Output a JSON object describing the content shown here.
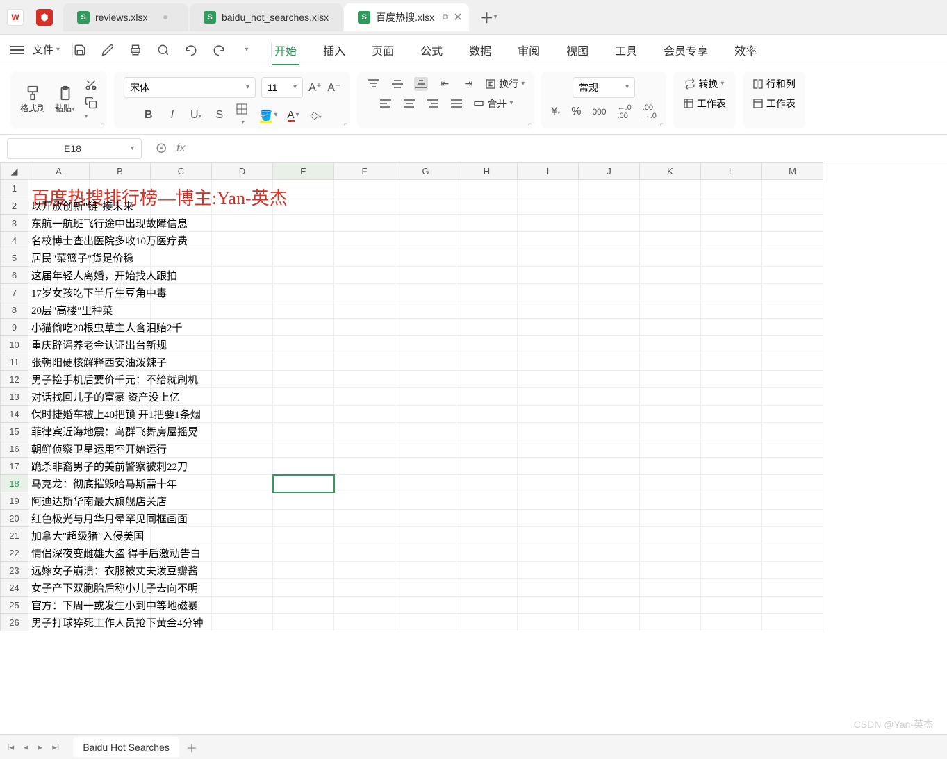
{
  "tabs": [
    {
      "label": "reviews.xlsx",
      "active": false,
      "hasDot": true
    },
    {
      "label": "baidu_hot_searches.xlsx",
      "active": false,
      "hasDot": false
    },
    {
      "label": "百度热搜.xlsx",
      "active": true,
      "hasDot": false,
      "hasWindowIcons": true
    }
  ],
  "menu": {
    "file": "文件",
    "tabs": [
      "开始",
      "插入",
      "页面",
      "公式",
      "数据",
      "审阅",
      "视图",
      "工具",
      "会员专享",
      "效率"
    ],
    "activeTab": "开始"
  },
  "ribbon": {
    "formatPainter": "格式刷",
    "paste": "粘贴",
    "fontName": "宋体",
    "fontSize": "11",
    "wrap": "换行",
    "merge": "合并",
    "numberFormat": "常规",
    "convert": "转换",
    "rowcol": "行和列",
    "worksheet": "工作表"
  },
  "formulaBar": {
    "nameBox": "E18",
    "fx": "fx",
    "formula": ""
  },
  "columns": [
    "A",
    "B",
    "C",
    "D",
    "E",
    "F",
    "G",
    "H",
    "I",
    "J",
    "K",
    "L",
    "M"
  ],
  "activeColumn": "E",
  "activeRow": 18,
  "selectedCell": "E18",
  "title": "百度热搜排行榜—博主:Yan-英杰",
  "dataRows": [
    "以开放创新\"链\"接未来",
    "东航一航班飞行途中出现故障信息",
    "名校博士查出医院多收10万医疗费",
    "居民\"菜篮子\"货足价稳",
    "这届年轻人离婚，开始找人跟拍",
    "17岁女孩吃下半斤生豆角中毒",
    "20层\"高楼\"里种菜",
    "小猫偷吃20根虫草主人含泪赔2千",
    "重庆辟谣养老金认证出台新规",
    "张朝阳硬核解释西安油泼辣子",
    "男子捡手机后要价千元：不给就刷机",
    "对话找回儿子的富豪 资产没上亿",
    "保时捷婚车被上40把锁 开1把要1条烟",
    "菲律宾近海地震：鸟群飞舞房屋摇晃",
    "朝鲜侦察卫星运用室开始运行",
    "跪杀非裔男子的美前警察被刺22刀",
    "马克龙：彻底摧毁哈马斯需十年",
    "阿迪达斯华南最大旗舰店关店",
    "红色极光与月华月晕罕见同框画面",
    "加拿大\"超级猪\"入侵美国",
    "情侣深夜变雌雄大盗 得手后激动告白",
    "远嫁女子崩溃：衣服被丈夫泼豆瓣酱",
    "女子产下双胞胎后称小儿子去向不明",
    "官方：下周一或发生小到中等地磁暴",
    "男子打球猝死工作人员抢下黄金4分钟"
  ],
  "sheetTab": "Baidu Hot Searches",
  "watermark": "CSDN @Yan-英杰"
}
